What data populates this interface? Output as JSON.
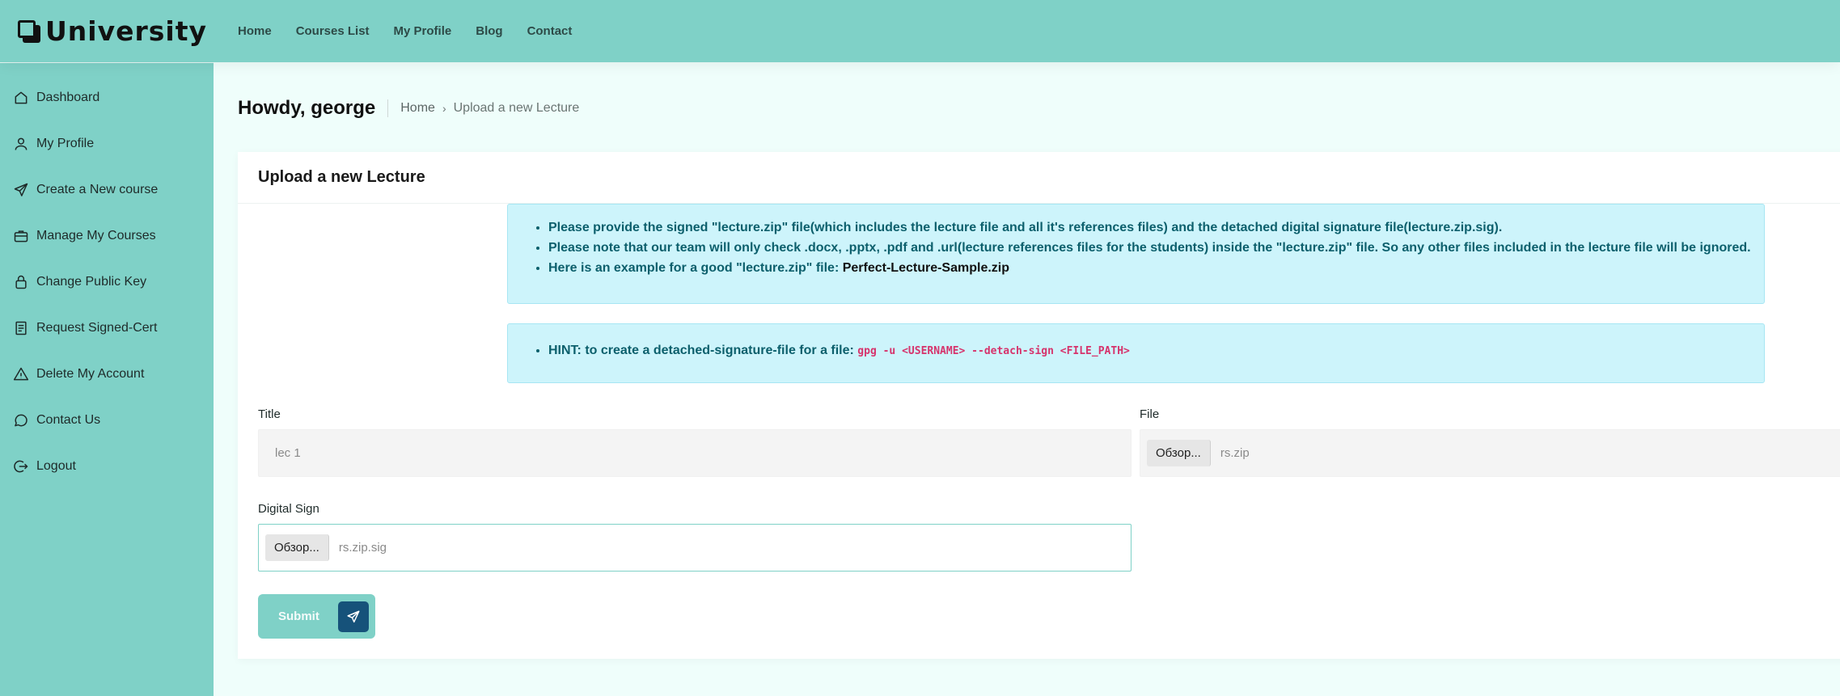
{
  "brand": {
    "name": "University",
    "logo_icon": "university-logo-icon"
  },
  "topnav": [
    {
      "label": "Home"
    },
    {
      "label": "Courses List"
    },
    {
      "label": "My Profile"
    },
    {
      "label": "Blog"
    },
    {
      "label": "Contact"
    }
  ],
  "sidebar": {
    "items": [
      {
        "label": "Dashboard",
        "icon": "home-icon"
      },
      {
        "label": "My Profile",
        "icon": "user-icon"
      },
      {
        "label": "Create a New course",
        "icon": "send-icon"
      },
      {
        "label": "Manage My Courses",
        "icon": "briefcase-icon"
      },
      {
        "label": "Change Public Key",
        "icon": "lock-icon"
      },
      {
        "label": "Request Signed-Cert",
        "icon": "document-icon"
      },
      {
        "label": "Delete My Account",
        "icon": "warning-icon"
      },
      {
        "label": "Contact Us",
        "icon": "chat-icon"
      },
      {
        "label": "Logout",
        "icon": "logout-icon"
      }
    ]
  },
  "header": {
    "greeting": "Howdy, george",
    "breadcrumb_home": "Home",
    "breadcrumb_current": "Upload a new Lecture"
  },
  "card": {
    "title": "Upload a new Lecture",
    "info_items": [
      "Please provide the signed \"lecture.zip\" file(which includes the lecture file and all it's references files) and the detached digital signature file(lecture.zip.sig).",
      "Please note that our team will only check .docx, .pptx, .pdf and .url(lecture references files for the students) inside the \"lecture.zip\" file. So any other files included in the lecture file will be ignored.",
      "Here is an example for a good \"lecture.zip\" file: "
    ],
    "example_link": "Perfect-Lecture-Sample.zip",
    "hint_text": "HINT: to create a detached-signature-file for a file: ",
    "hint_code": "gpg -u <USERNAME> --detach-sign <FILE_PATH>",
    "title_label": "Title",
    "title_value": "lec 1",
    "file_label": "File",
    "file_button": "Обзор...",
    "file_value": "rs.zip",
    "sign_label": "Digital Sign",
    "sign_button": "Обзор...",
    "sign_value": "rs.zip.sig",
    "submit_label": "Submit"
  },
  "colors": {
    "accent": "#7fd1c7",
    "submit_icon_bg": "#16527a",
    "alert_bg": "#cdf4fb",
    "alert_text": "#0c5f6c",
    "code": "#d6336c"
  }
}
